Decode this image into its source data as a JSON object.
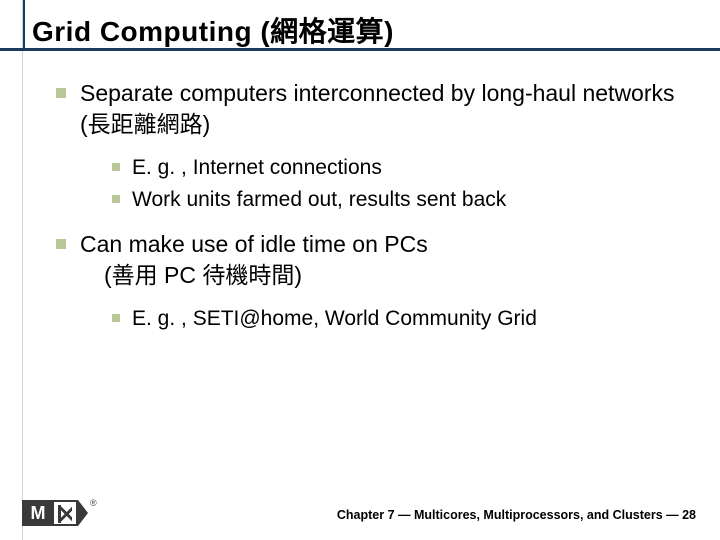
{
  "title": "Grid Computing (網格運算)",
  "bullets": {
    "b1": "Separate computers interconnected by long-haul networks (長距離網路)",
    "b1a": "E. g. , Internet connections",
    "b1b": "Work units farmed out, results sent back",
    "b2_line1": "Can make use of idle time on PCs",
    "b2_line2": "(善用 PC 待機時間)",
    "b2a": "E. g. , SETI@home, World Community Grid"
  },
  "footer": "Chapter 7 — Multicores, Multiprocessors, and Clusters — 28",
  "logo": {
    "reg": "®"
  }
}
